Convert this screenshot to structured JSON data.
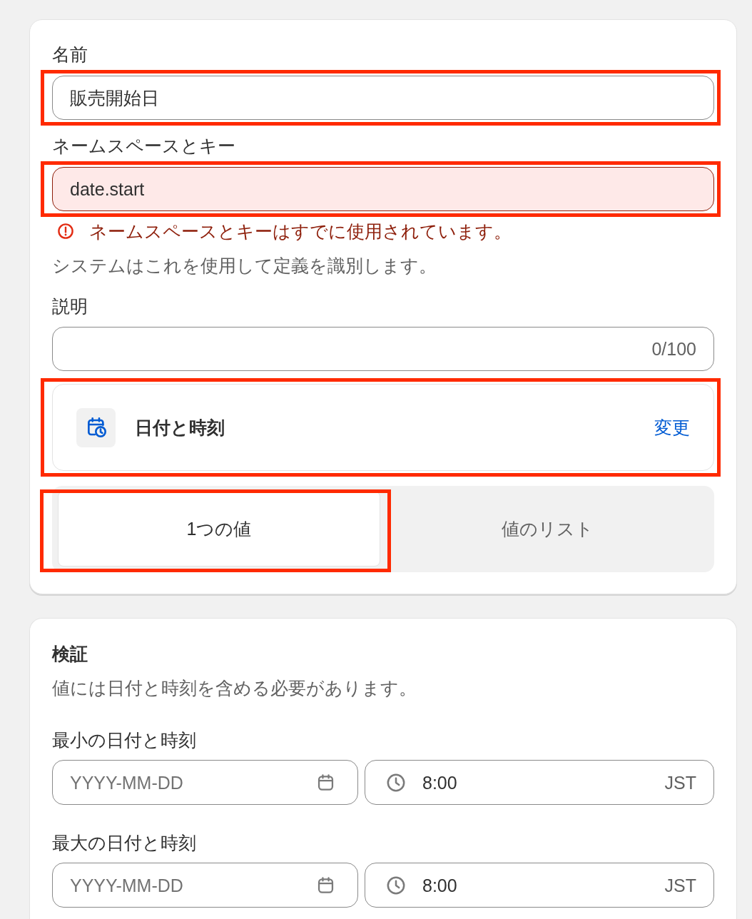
{
  "definition": {
    "name_field": {
      "label": "名前",
      "value": "販売開始日",
      "highlighted": true
    },
    "namespace_field": {
      "label": "ネームスペースとキー",
      "value": "date.start",
      "invalid": true,
      "error": "ネームスペースとキーはすでに使用されています。",
      "help": "システムはこれを使用して定義を識別します。",
      "highlighted": true
    },
    "description_field": {
      "label": "説明",
      "counter": "0/100"
    },
    "type_card": {
      "label": "日付と時刻",
      "action": "変更",
      "highlighted": true
    },
    "value_mode": [
      {
        "label": "1つの値",
        "selected": true,
        "highlighted": true
      },
      {
        "label": "値のリスト",
        "selected": false,
        "highlighted": false
      }
    ]
  },
  "validation": {
    "title": "検証",
    "description": "値には日付と時刻を含める必要があります。",
    "ranges": [
      {
        "label": "最小の日付と時刻",
        "date": {
          "placeholder": "YYYY-MM-DD"
        },
        "time": "8:00",
        "timezone": "JST"
      },
      {
        "label": "最大の日付と時刻",
        "date": {
          "placeholder": "YYYY-MM-DD"
        },
        "time": "8:00",
        "timezone": "JST"
      }
    ]
  }
}
